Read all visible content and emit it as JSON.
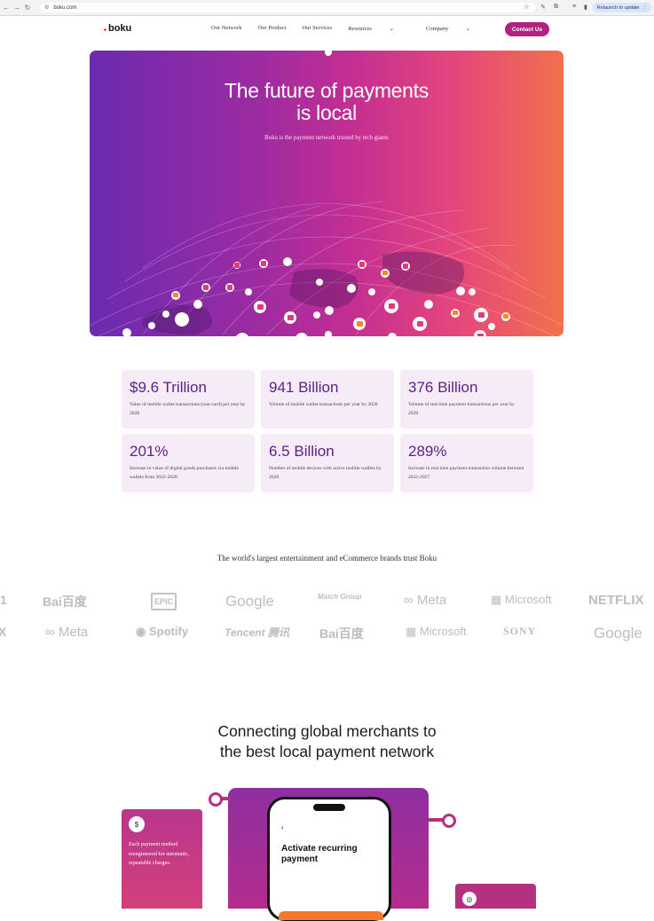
{
  "browser": {
    "url": "boku.com",
    "relaunch_label": "Relaunch to update"
  },
  "nav": {
    "logo": "boku",
    "items": [
      {
        "label": "Our Network"
      },
      {
        "label": "Our Product"
      },
      {
        "label": "Our Services"
      },
      {
        "label": "Resources",
        "chevron": true
      },
      {
        "label": "Company",
        "chevron": true
      }
    ],
    "contact_label": "Contact Us"
  },
  "hero": {
    "title_line1": "The future of payments",
    "title_line2": "is local",
    "subtitle": "Boku is the payment network trusted by tech giants"
  },
  "stats": [
    {
      "value": "$9.6 Trillion",
      "desc": "Value of mobile wallet transactions (non-card) per year by 2028"
    },
    {
      "value": "941 Billion",
      "desc": "Volume of mobile wallet transactions per year by 2028"
    },
    {
      "value": "376 Billion",
      "desc": "Volume of real time payment transactions per year by 2028"
    },
    {
      "value": "201%",
      "desc": "Increase in value of digital goods purchases via mobile wallets from 2022-2028"
    },
    {
      "value": "6.5 Billion",
      "desc": "Number of mobile devices with active mobile wallets by 2028"
    },
    {
      "value": "289%",
      "desc": "Increase in real time payment transaction volume between 2022-2027"
    }
  ],
  "trust": {
    "heading": "The world's largest entertainment and eCommerce brands trust Boku",
    "row1": [
      "1",
      "Bai百度",
      "EPIC",
      "Google",
      "Match Group",
      "∞ Meta",
      "Microsoft",
      "NETFLIX"
    ],
    "row2": [
      "X",
      "∞ Meta",
      "Spotify",
      "Tencent 腾讯",
      "Bai百度",
      "Microsoft",
      "SONY",
      "Google"
    ]
  },
  "section2": {
    "heading_line1": "Connecting global merchants to",
    "heading_line2": "the best local payment network",
    "card_text": "Each payment method reengineered for automatic, repeatable charges.",
    "phone_back": "‹",
    "phone_title": "Activate recurring payment"
  },
  "colors": {
    "brand_magenta": "#b5207f",
    "stat_value": "#5b1f85",
    "stat_bg": "#f6ecf8",
    "accent_orange": "#f27a2a"
  }
}
